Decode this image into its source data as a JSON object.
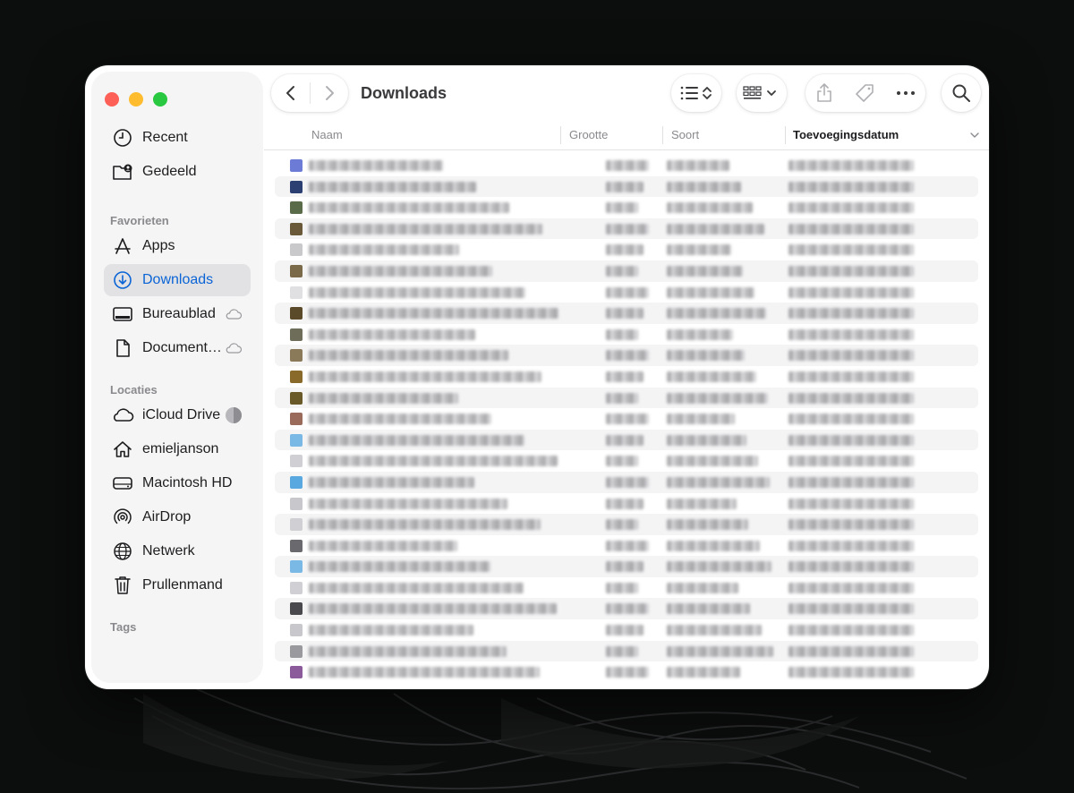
{
  "window": {
    "title": "Downloads"
  },
  "sidebar": {
    "items_top": [
      {
        "label": "Recent",
        "icon": "clock-icon"
      },
      {
        "label": "Gedeeld",
        "icon": "shared-folder-icon"
      }
    ],
    "favorites_heading": "Favorieten",
    "favorites": [
      {
        "label": "Apps",
        "icon": "apps-icon"
      },
      {
        "label": "Downloads",
        "icon": "download-icon",
        "active": true
      },
      {
        "label": "Bureaublad",
        "icon": "desktop-icon",
        "cloud": true
      },
      {
        "label": "Document…",
        "icon": "document-icon",
        "cloud": true
      }
    ],
    "locations_heading": "Locaties",
    "locations": [
      {
        "label": "iCloud Drive",
        "icon": "cloud-icon",
        "progress": true
      },
      {
        "label": "emieljanson",
        "icon": "home-icon"
      },
      {
        "label": "Macintosh HD",
        "icon": "harddisk-icon"
      },
      {
        "label": "AirDrop",
        "icon": "airdrop-icon"
      },
      {
        "label": "Netwerk",
        "icon": "network-icon"
      },
      {
        "label": "Prullenmand",
        "icon": "trash-icon"
      }
    ],
    "tags_heading": "Tags"
  },
  "columns": {
    "name": "Naam",
    "size": "Grootte",
    "kind": "Soort",
    "date_added": "Toevoegingsdatum"
  },
  "colors": {
    "accent": "#0a64d6",
    "close": "#fe5f57",
    "minimize": "#febc2e",
    "maximize": "#28c840"
  }
}
